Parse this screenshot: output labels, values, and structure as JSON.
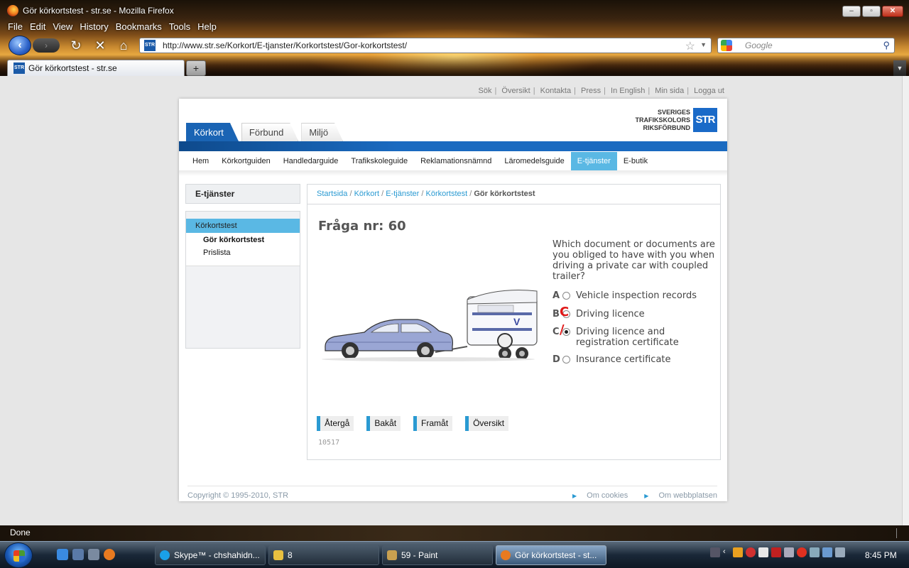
{
  "browser": {
    "window_title": "Gör körkortstest - str.se - Mozilla Firefox",
    "menu": [
      "File",
      "Edit",
      "View",
      "History",
      "Bookmarks",
      "Tools",
      "Help"
    ],
    "url": "http://www.str.se/Korkort/E-tjanster/Korkortstest/Gor-korkortstest/",
    "site_icon": "STR",
    "search_placeholder": "Google",
    "tab_title": "Gör körkortstest - str.se",
    "new_tab": "+",
    "status": "Done"
  },
  "site": {
    "top_links": [
      "Sök",
      "Översikt",
      "Kontakta",
      "Press",
      "In English",
      "Min sida",
      "Logga ut"
    ],
    "logo_line1": "SVERIGES",
    "logo_line2": "TRAFIKSKOLORS",
    "logo_line3": "RIKSFÖRBUND",
    "logo_badge": "STR",
    "main_tabs": [
      "Körkort",
      "Förbund",
      "Miljö"
    ],
    "sub_nav": [
      "Hem",
      "Körkortguiden",
      "Handledarguide",
      "Trafikskoleguide",
      "Reklamationsnämnd",
      "Läromedelsguide",
      "E-tjänster",
      "E-butik"
    ],
    "sidebar": {
      "heading": "E-tjänster",
      "selected": "Körkortstest",
      "item_current": "Gör körkortstest",
      "item_other": "Prislista"
    },
    "breadcrumb": {
      "items": [
        "Startsida",
        "Körkort",
        "E-tjänster",
        "Körkortstest"
      ],
      "current": "Gör körkortstest"
    },
    "question": {
      "title": "Fråga nr: 60",
      "text": "Which document or documents are you obliged to have with you when driving a private car with coupled trailer?",
      "options": [
        {
          "letter": "A",
          "text": "Vehicle inspection records",
          "checked": false
        },
        {
          "letter": "B",
          "text": "Driving licence",
          "checked": false
        },
        {
          "letter": "C",
          "text": "Driving licence and registration certificate",
          "checked": true
        },
        {
          "letter": "D",
          "text": "Insurance certificate",
          "checked": false
        }
      ],
      "id": "10517"
    },
    "buttons": [
      "Återgå",
      "Bakåt",
      "Framåt",
      "Översikt"
    ],
    "footer": {
      "copyright": "Copyright © 1995-2010, STR",
      "links": [
        "Om cookies",
        "Om webbplatsen"
      ]
    }
  },
  "taskbar": {
    "tasks": [
      "Skype™ - chshahidn...",
      "8",
      "59 - Paint",
      "Gör körkortstest - st..."
    ],
    "clock": "8:45 PM"
  }
}
